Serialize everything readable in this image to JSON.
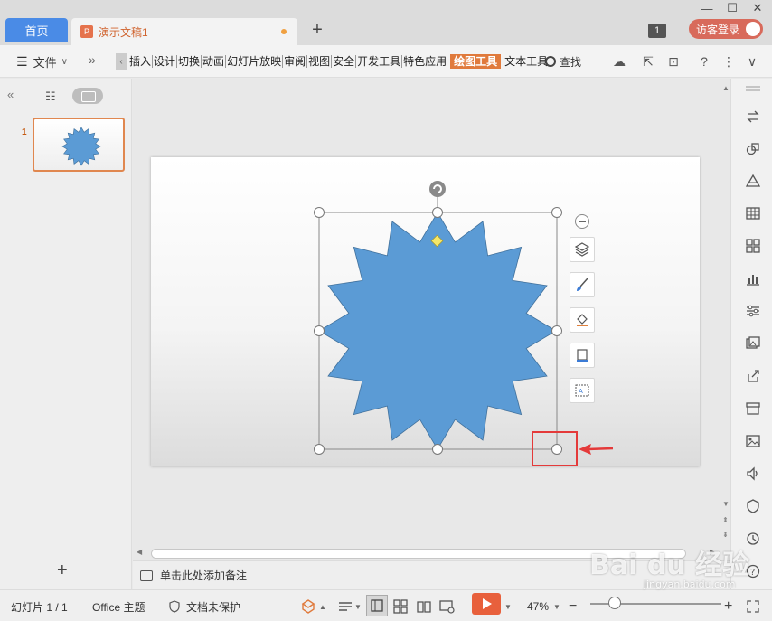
{
  "app": {
    "home_tab": "首页",
    "doc_tab": "演示文稿1",
    "window_badge": "1",
    "login_label": "访客登录"
  },
  "menu": {
    "file_label": "文件",
    "items": [
      "插入",
      "设计",
      "切换",
      "动画",
      "幻灯片放映",
      "审阅",
      "视图",
      "安全",
      "开发工具",
      "特色应用",
      "绘图工具",
      "文本工具"
    ],
    "active_item": "绘图工具",
    "find_label": "查找"
  },
  "slides_panel": {
    "slide_numbers": [
      "1"
    ]
  },
  "notes": {
    "placeholder": "单击此处添加备注"
  },
  "statusbar": {
    "slide_counter": "幻灯片 1 / 1",
    "theme": "Office 主题",
    "protection": "文档未保护",
    "zoom": "47%"
  },
  "shape": {
    "type": "star-16",
    "fill_color": "#5b9bd5",
    "outline_color": "#41719c"
  },
  "annotation": {
    "highlight_color": "#e43a3a"
  },
  "watermark": {
    "brand": "Bai du 经验",
    "url": "jingyan.baidu.com"
  },
  "icons": {
    "float_tools": [
      "layers-icon",
      "brush-icon",
      "fill-icon",
      "border-icon",
      "text-wrap-icon"
    ],
    "right_sidebar": [
      "swap-icon",
      "shapes-icon",
      "triangle-icon",
      "table-icon",
      "grid-icon",
      "chart-icon",
      "sliders-icon",
      "image-gallery-icon",
      "share-icon",
      "archive-icon",
      "picture-icon",
      "sound-icon",
      "shield-icon",
      "history-icon",
      "help-icon"
    ]
  }
}
